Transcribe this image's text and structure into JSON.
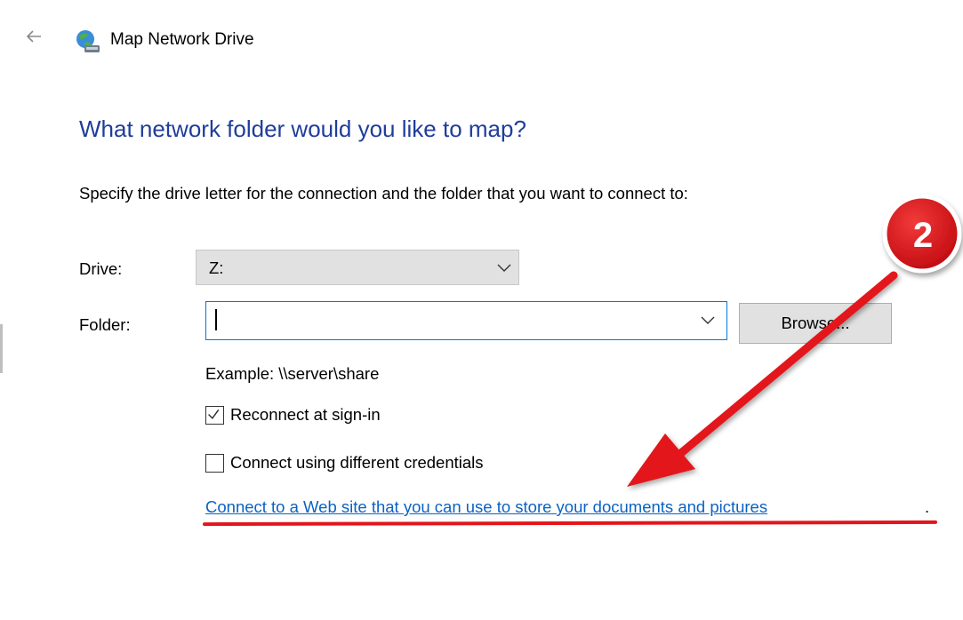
{
  "window": {
    "title": "Map Network Drive",
    "icon": "network-drive-icon",
    "back": "back-arrow-icon"
  },
  "content": {
    "heading": "What network folder would you like to map?",
    "instruction": "Specify the drive letter for the connection and the folder that you want to connect to:",
    "drive_label": "Drive:",
    "drive_value": "Z:",
    "folder_label": "Folder:",
    "folder_value": "",
    "browse_label": "Browse...",
    "example": "Example: \\\\server\\share",
    "reconnect_label": "Reconnect at sign-in",
    "reconnect_checked": true,
    "credentials_label": "Connect using different credentials",
    "credentials_checked": false,
    "web_link": "Connect to a Web site that you can use to store your documents and pictures",
    "link_period": "."
  },
  "annotation": {
    "badge_number": "2",
    "color": "#e3151a"
  },
  "colors": {
    "heading": "#1f3d9a",
    "link": "#0b62c4",
    "focus_border": "#0078d7"
  }
}
